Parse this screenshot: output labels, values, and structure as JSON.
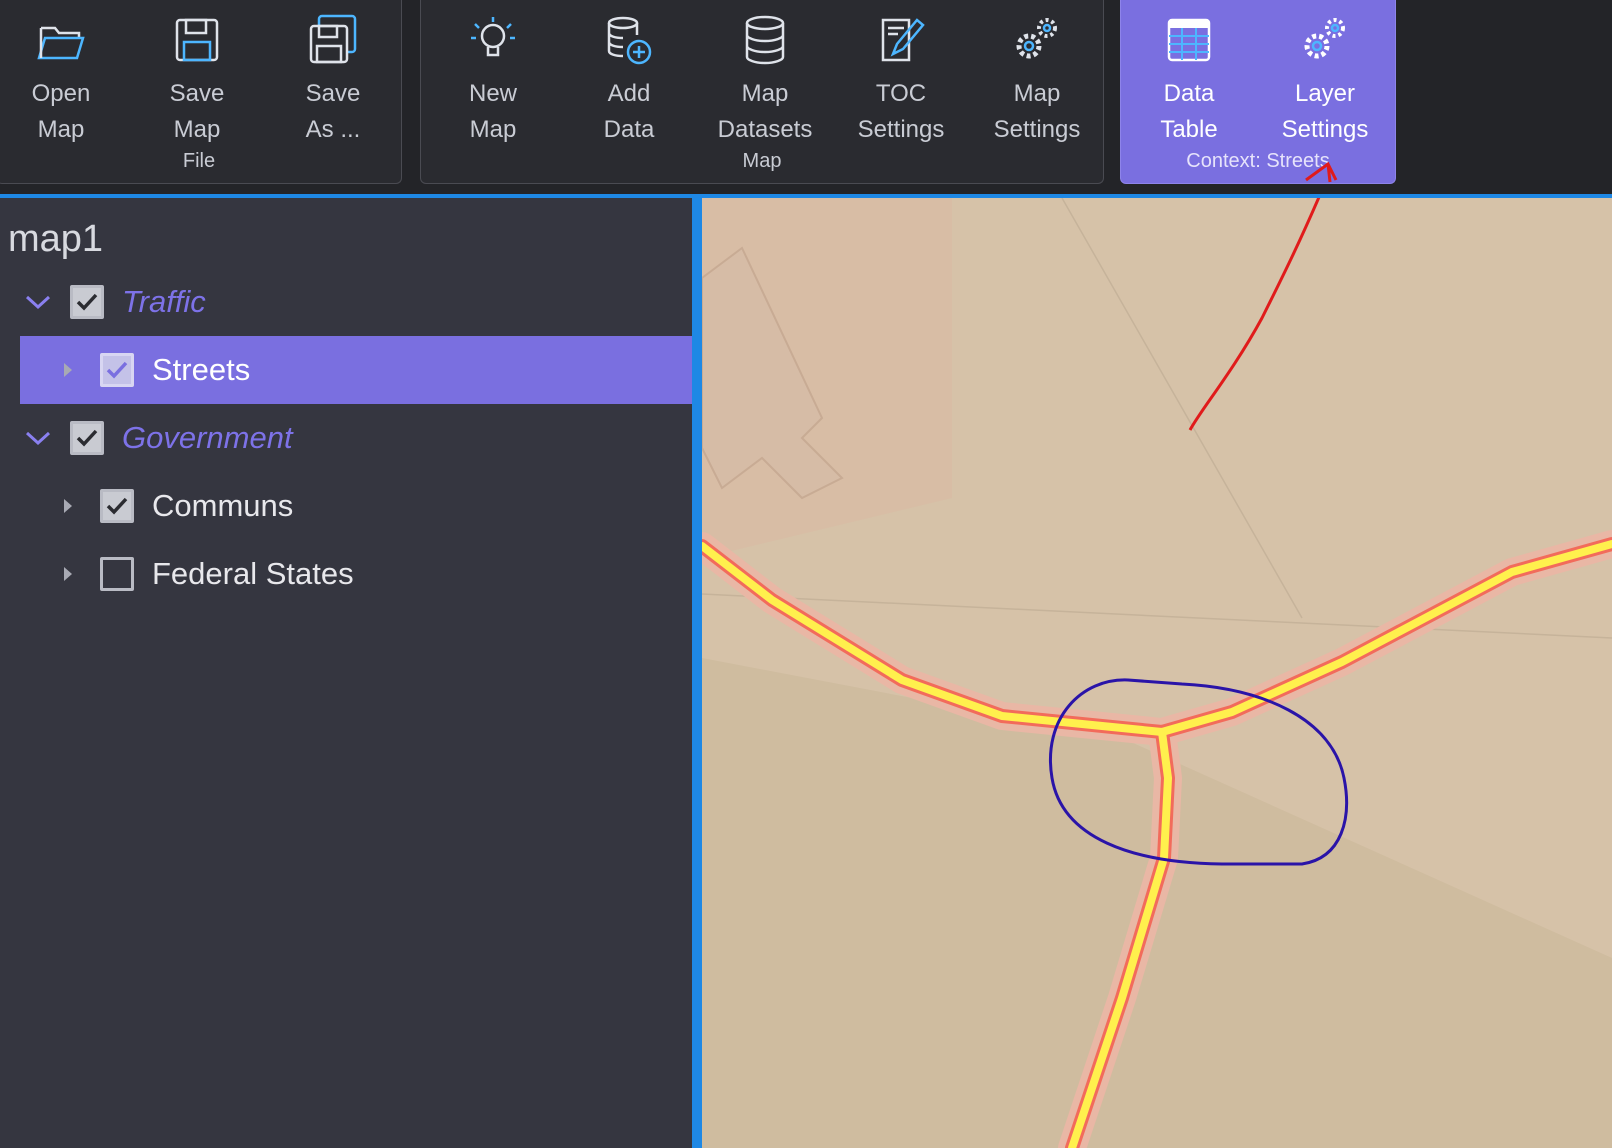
{
  "ribbon": {
    "groups": [
      {
        "label": "File",
        "buttons": [
          {
            "line1": "Open",
            "line2": "Map",
            "icon": "folder-open-icon"
          },
          {
            "line1": "Save",
            "line2": "Map",
            "icon": "save-icon"
          },
          {
            "line1": "Save",
            "line2": "As ...",
            "icon": "save-as-icon"
          }
        ]
      },
      {
        "label": "Map",
        "buttons": [
          {
            "line1": "New",
            "line2": "Map",
            "icon": "lightbulb-icon"
          },
          {
            "line1": "Add",
            "line2": "Data",
            "icon": "database-add-icon"
          },
          {
            "line1": "Map",
            "line2": "Datasets",
            "icon": "database-icon"
          },
          {
            "line1": "TOC",
            "line2": "Settings",
            "icon": "edit-document-icon"
          },
          {
            "line1": "Map",
            "line2": "Settings",
            "icon": "gears-icon"
          }
        ]
      },
      {
        "label": "Context: Streets",
        "buttons": [
          {
            "line1": "Data",
            "line2": "Table",
            "icon": "table-icon"
          },
          {
            "line1": "Layer",
            "line2": "Settings",
            "icon": "gears-icon"
          }
        ]
      }
    ]
  },
  "toc": {
    "map_name": "map1",
    "items": [
      {
        "label": "Traffic",
        "checked": true,
        "type": "group"
      },
      {
        "label": "Streets",
        "checked": true,
        "type": "layer",
        "selected": true
      },
      {
        "label": "Government",
        "checked": true,
        "type": "group"
      },
      {
        "label": "Communs",
        "checked": true,
        "type": "layer"
      },
      {
        "label": "Federal States",
        "checked": false,
        "type": "layer"
      }
    ]
  },
  "colors": {
    "accent": "#7a6fe0",
    "splitter": "#1e88e5",
    "road_fill": "#fff04d",
    "road_casing": "#f26b5b",
    "map_background": "#d6c2a8",
    "annotation_arrow": "#e01b1b",
    "annotation_circle": "#2a14a8"
  }
}
